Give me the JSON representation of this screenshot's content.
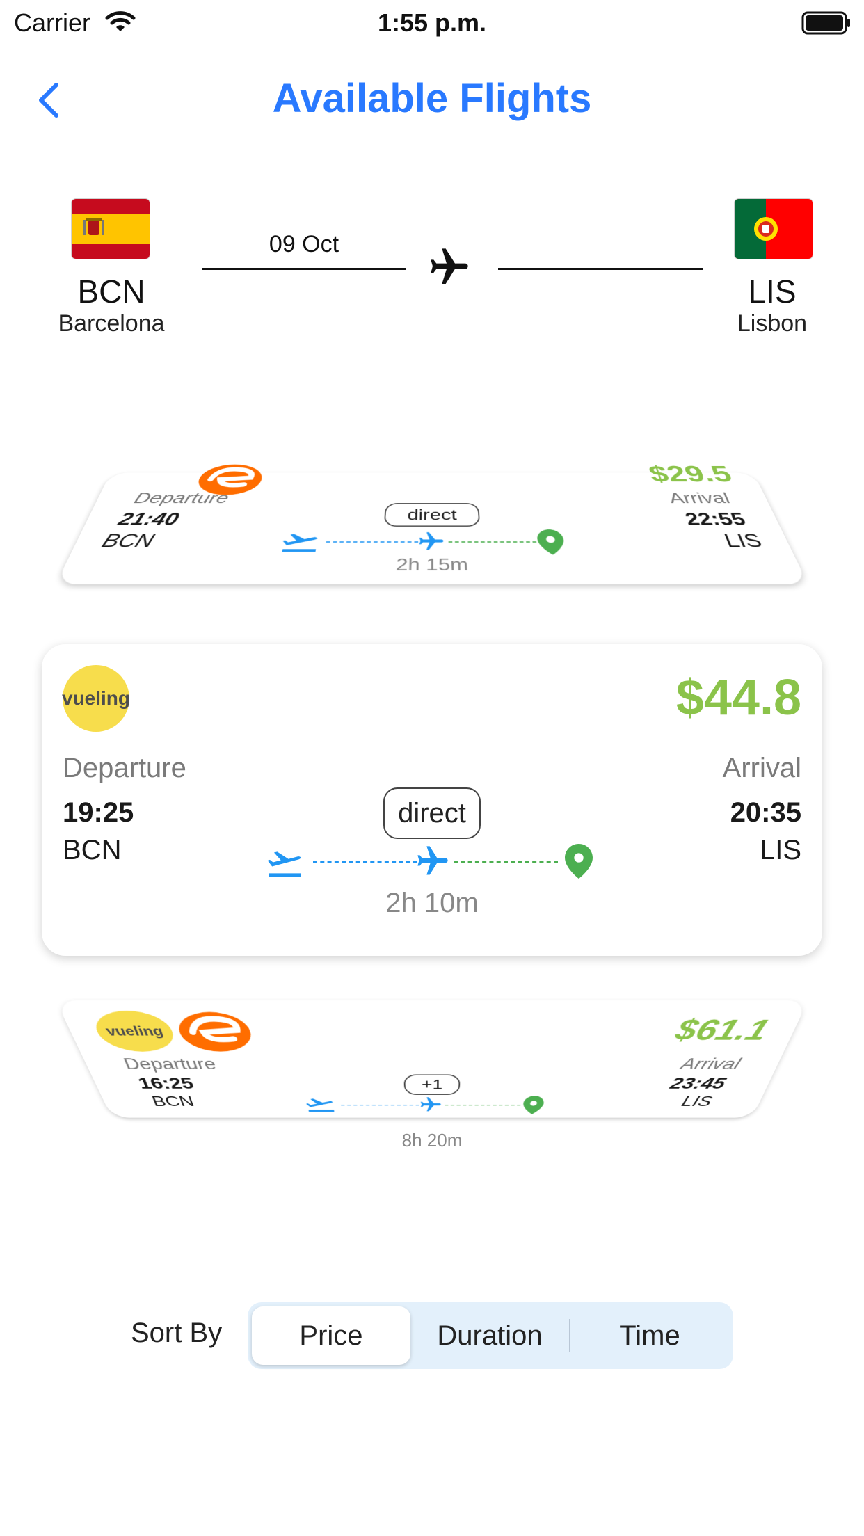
{
  "status_bar": {
    "carrier": "Carrier",
    "time": "1:55 p.m."
  },
  "header": {
    "title": "Available Flights",
    "back_icon": "chevron-left-icon"
  },
  "route": {
    "date": "09 Oct",
    "origin": {
      "code": "BCN",
      "city": "Barcelona",
      "flag": "spain-flag"
    },
    "destination": {
      "code": "LIS",
      "city": "Lisbon",
      "flag": "portugal-flag"
    }
  },
  "flights": [
    {
      "airline_logos": [
        "easyjet-e-logo"
      ],
      "price": "$29.5",
      "departure_label": "Departure",
      "departure_time": "21:40",
      "departure_code": "BCN",
      "arrival_label": "Arrival",
      "arrival_time": "22:55",
      "arrival_code": "LIS",
      "stops": "direct",
      "duration": "2h 15m"
    },
    {
      "airline_logos": [
        "vueling-logo"
      ],
      "airline_text": "vueling",
      "price": "$44.8",
      "departure_label": "Departure",
      "departure_time": "19:25",
      "departure_code": "BCN",
      "arrival_label": "Arrival",
      "arrival_time": "20:35",
      "arrival_code": "LIS",
      "stops": "direct",
      "duration": "2h 10m"
    },
    {
      "airline_logos": [
        "vueling-logo",
        "easyjet-e-logo"
      ],
      "airline_text": "vueling",
      "price": "$61.1",
      "departure_label": "Departure",
      "departure_time": "16:25",
      "departure_code": "BCN",
      "arrival_label": "Arrival",
      "arrival_time": "23:45",
      "arrival_code": "LIS",
      "stops": "+1",
      "duration": "8h 20m"
    }
  ],
  "sort": {
    "label": "Sort By",
    "options": [
      "Price",
      "Duration",
      "Time"
    ],
    "selected": "Price"
  },
  "colors": {
    "accent": "#2979ff",
    "price_green": "#8bc34a",
    "plane_blue": "#2196f3",
    "pin_green": "#4caf50",
    "vueling_yellow": "#f7dd4c",
    "easy_orange": "#ff6d00",
    "segment_bg": "#e3f0fb"
  }
}
